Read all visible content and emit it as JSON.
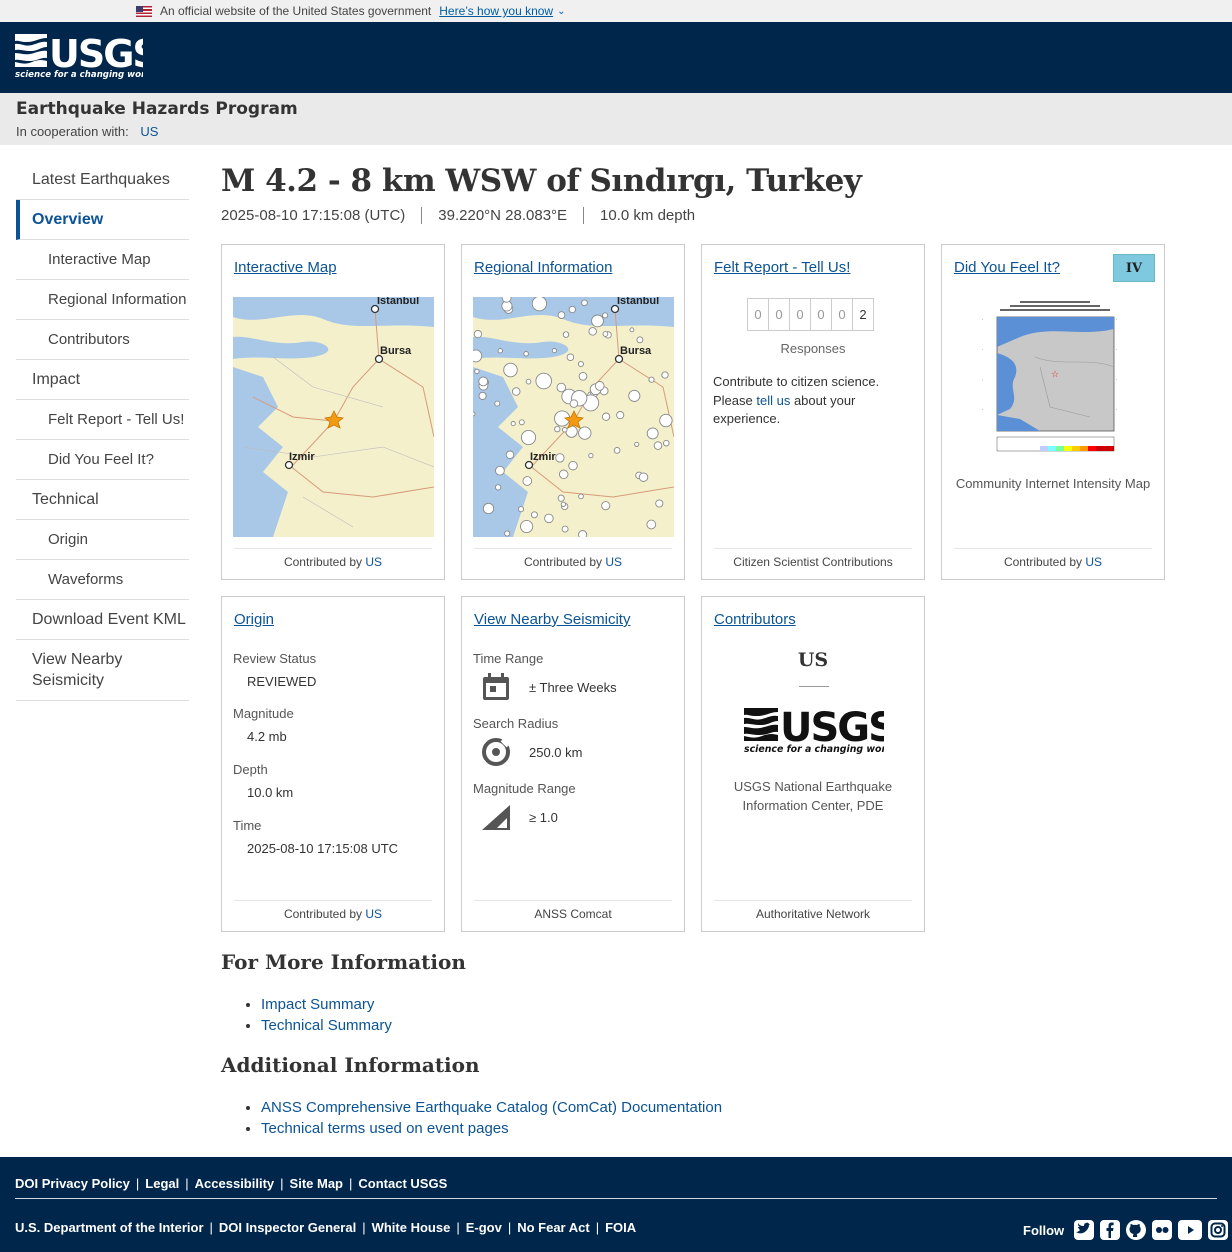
{
  "gov_banner": {
    "text": "An official website of the United States government",
    "link": "Here’s how you know"
  },
  "header": {
    "program": "Earthquake Hazards Program",
    "coop_label": "In cooperation with:",
    "coop_link": "US",
    "logo_tagline": "science for a changing world"
  },
  "sidebar": [
    {
      "label": "Latest Earthquakes",
      "level": "top"
    },
    {
      "label": "Overview",
      "level": "top",
      "active": true
    },
    {
      "label": "Interactive Map",
      "level": "sub"
    },
    {
      "label": "Regional Information",
      "level": "sub"
    },
    {
      "label": "Contributors",
      "level": "sub"
    },
    {
      "label": "Impact",
      "level": "top"
    },
    {
      "label": "Felt Report - Tell Us!",
      "level": "sub"
    },
    {
      "label": "Did You Feel It?",
      "level": "sub"
    },
    {
      "label": "Technical",
      "level": "top"
    },
    {
      "label": "Origin",
      "level": "sub"
    },
    {
      "label": "Waveforms",
      "level": "sub"
    },
    {
      "label": "Download Event KML",
      "level": "top"
    },
    {
      "label": "View Nearby Seismicity",
      "level": "top"
    }
  ],
  "event": {
    "title": "M 4.2 - 8 km WSW of Sındırgı, Turkey",
    "time": "2025-08-10 17:15:08 (UTC)",
    "coords": "39.220°N 28.083°E",
    "depth": "10.0 km depth"
  },
  "cards": {
    "interactive_map": {
      "title": "Interactive Map",
      "contributed": "Contributed by",
      "source": "US",
      "cities": [
        "Istanbul",
        "Bursa",
        "Izmir"
      ]
    },
    "regional": {
      "title": "Regional Information",
      "contributed": "Contributed by",
      "source": "US",
      "cities": [
        "Istanbul",
        "Bursa",
        "Izmir"
      ]
    },
    "felt_report": {
      "title": "Felt Report - Tell Us!",
      "digits": [
        "0",
        "0",
        "0",
        "0",
        "0",
        "2"
      ],
      "responses": "Responses",
      "text_before": "Contribute to citizen science. Please ",
      "link": "tell us",
      "text_after": " about your experience.",
      "footer": "Citizen Scientist Contributions"
    },
    "dyfi": {
      "title": "Did You Feel It?",
      "intensity": "IV",
      "caption": "Community Internet Intensity Map",
      "contributed": "Contributed by",
      "source": "US"
    },
    "origin": {
      "title": "Origin",
      "review_label": "Review Status",
      "review": "REVIEWED",
      "mag_label": "Magnitude",
      "mag": "4.2 mb",
      "depth_label": "Depth",
      "depth": "10.0 km",
      "time_label": "Time",
      "time": "2025-08-10 17:15:08 UTC",
      "contributed": "Contributed by",
      "source": "US"
    },
    "nearby": {
      "title": "View Nearby Seismicity",
      "range_label": "Time Range",
      "range": "± Three Weeks",
      "radius_label": "Search Radius",
      "radius": "250.0 km",
      "magrange_label": "Magnitude Range",
      "magrange": "≥ 1.0",
      "footer": "ANSS Comcat"
    },
    "contributors": {
      "title": "Contributors",
      "code": "US",
      "org": "USGS National Earthquake Information Center, PDE",
      "footer": "Authoritative Network",
      "tagline": "science for a changing world"
    }
  },
  "more_info": {
    "heading": "For More Information",
    "links": [
      "Impact Summary",
      "Technical Summary"
    ]
  },
  "additional": {
    "heading": "Additional Information",
    "links": [
      "ANSS Comprehensive Earthquake Catalog (ComCat) Documentation",
      "Technical terms used on event pages"
    ]
  },
  "footer": {
    "row1": [
      "DOI Privacy Policy",
      "Legal",
      "Accessibility",
      "Site Map",
      "Contact USGS"
    ],
    "row2": [
      "U.S. Department of the Interior",
      "DOI Inspector General",
      "White House",
      "E-gov",
      "No Fear Act",
      "FOIA"
    ],
    "follow": "Follow",
    "social_icons": [
      "twitter-icon",
      "facebook-icon",
      "github-icon",
      "flickr-icon",
      "youtube-icon",
      "instagram-icon"
    ]
  },
  "colors": {
    "header_bg": "#00264c",
    "link": "#0b5394",
    "dyfi_badge": "#7ec9df",
    "epicenter": "#f29b11"
  }
}
